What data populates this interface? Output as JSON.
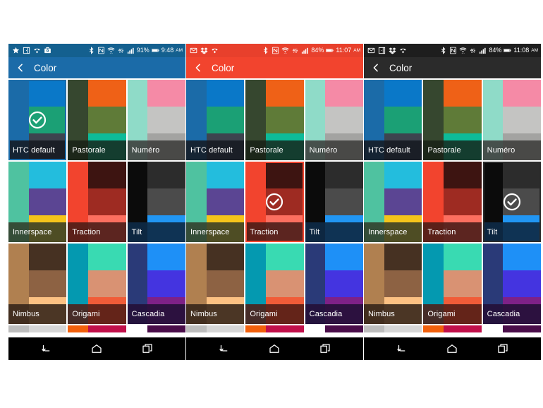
{
  "screen": {
    "title": "Color",
    "back_icon": "chevron-left-icon"
  },
  "panels": [
    {
      "id": "panel-1",
      "accent": "#1b6ba8",
      "statusbar_bg": "#14608f",
      "left_icons": [
        "star-icon",
        "door-icon",
        "missed-call-icon",
        "briefcase-icon"
      ],
      "right_icons": [
        "bluetooth-icon",
        "nfc-icon",
        "wifi-icon",
        "4g-icon",
        "signal-icon"
      ],
      "battery": "91%",
      "time": "9:48",
      "ampm": "AM",
      "selected": "HTC default"
    },
    {
      "id": "panel-2",
      "accent": "#f2442e",
      "statusbar_bg": "#e8402c",
      "left_icons": [
        "mail-icon",
        "dropbox-icon",
        "missed-call-icon"
      ],
      "right_icons": [
        "bluetooth-icon",
        "nfc-icon",
        "wifi-icon",
        "4g-icon",
        "signal-icon"
      ],
      "battery": "84%",
      "time": "11:07",
      "ampm": "AM",
      "selected": "Traction"
    },
    {
      "id": "panel-3",
      "accent": "#2b2b2b",
      "statusbar_bg": "#1e1e1e",
      "left_icons": [
        "mail-icon",
        "door-icon",
        "dropbox-icon",
        "missed-call-icon"
      ],
      "right_icons": [
        "bluetooth-icon",
        "nfc-icon",
        "wifi-icon",
        "4g-icon",
        "signal-icon"
      ],
      "battery": "84%",
      "time": "11:08",
      "ampm": "AM",
      "selected": "Tilt"
    }
  ],
  "themes": [
    [
      {
        "name": "HTC default",
        "left": "#1b6ba8",
        "right": [
          "#0a78c8",
          "#1ba075",
          "#3d444f"
        ],
        "label_bg": "rgba(20,24,30,0.85)"
      },
      {
        "name": "Pastorale",
        "left": "#36472f",
        "right": [
          "#ef6117",
          "#5f7b38",
          "#0dbb9a"
        ],
        "label_bg": "rgba(22,30,20,0.80)"
      },
      {
        "name": "Numéro",
        "left": "#8fdbc8",
        "right": [
          "#f58aa6",
          "#c4c4c2",
          "#a3a3a1"
        ],
        "label_bg": "rgba(60,60,58,0.88)"
      }
    ],
    [
      {
        "name": "Innerspace",
        "left": "#4fc2a0",
        "right": [
          "#23bddd",
          "#5b4593",
          "#f5c41b"
        ],
        "label_bg": "rgba(48,56,38,0.85)"
      },
      {
        "name": "Traction",
        "left": "#f2442e",
        "right": [
          "#3d1411",
          "#9e2b22",
          "#fc6f60"
        ],
        "label_bg": "rgba(70,27,23,0.88)"
      },
      {
        "name": "Tilt",
        "left": "#0b0b0b",
        "right": [
          "#2c2c2c",
          "#4b4b4b",
          "#2196f3"
        ],
        "label_bg": "rgba(14,42,70,0.92)"
      }
    ],
    [
      {
        "name": "Nimbus",
        "left": "#b08050",
        "right": [
          "#463122",
          "#8d6243",
          "#fcc183"
        ],
        "label_bg": "rgba(50,34,24,0.88)"
      },
      {
        "name": "Origami",
        "left": "#0499b0",
        "right": [
          "#39dab2",
          "#d99273",
          "#f15c38"
        ],
        "label_bg": "rgba(80,28,20,0.88)"
      },
      {
        "name": "Cascadia",
        "left": "#2a3a78",
        "right": [
          "#1e90f7",
          "#4434e0",
          "#7e2187"
        ],
        "label_bg": "rgba(35,16,55,0.90)"
      }
    ]
  ],
  "peek_row": [
    {
      "name": "peek-1",
      "left": "#bdbdbd",
      "right": [
        "#d6d6d6"
      ]
    },
    {
      "name": "peek-2",
      "left": "#f2600c",
      "right": [
        "#c1104a"
      ]
    },
    {
      "name": "peek-3",
      "left": "#ffffff",
      "right": [
        "#4a0d4a"
      ]
    }
  ],
  "navbar": {
    "back_label": "back-button",
    "home_label": "home-button",
    "recents_label": "recents-button"
  }
}
